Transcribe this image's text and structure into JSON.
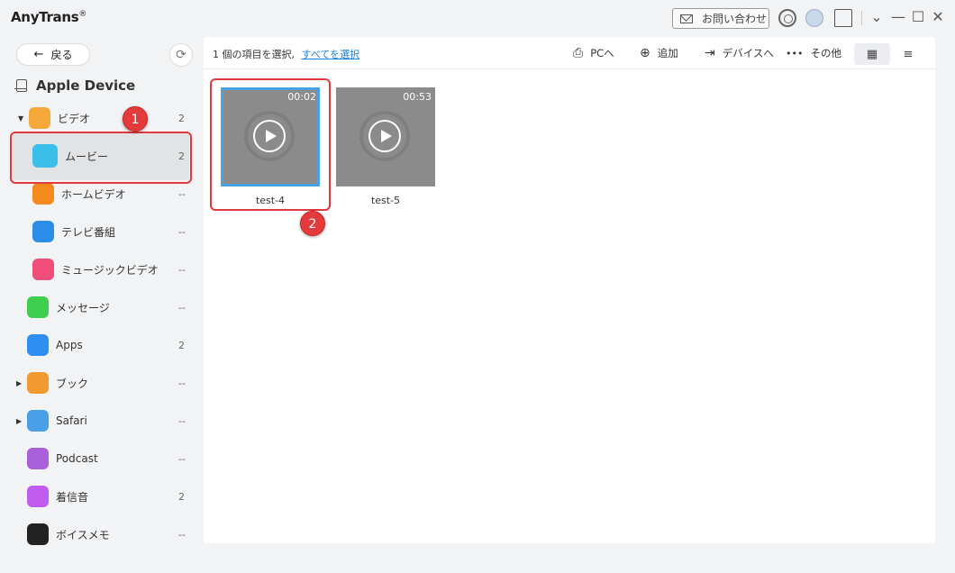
{
  "app": {
    "title": "AnyTrans",
    "reg": "®"
  },
  "titlebar": {
    "contact_label": "お問い合わせ",
    "controls": {
      "chevron": "⌄",
      "minimize": "—",
      "maximize": "☐",
      "close": "✕"
    }
  },
  "sidebar": {
    "back_label": "戻る",
    "back_arrow": "←",
    "refresh_icon": "⟳",
    "device_name": "Apple Device",
    "items": [
      {
        "label": "ビデオ",
        "count": "2",
        "caret": "▼",
        "icon": "video-category-icon",
        "color": "#f4a93a"
      },
      {
        "label": "ムービー",
        "count": "2",
        "icon": "clapperboard-icon",
        "color": "#3ac0e8"
      },
      {
        "label": "ホームビデオ",
        "count": "--",
        "icon": "home-video-icon",
        "color": "#f58a1f"
      },
      {
        "label": "テレビ番組",
        "count": "--",
        "icon": "tv-icon",
        "color": "#2b8de6"
      },
      {
        "label": "ミュージックビデオ",
        "count": "--",
        "icon": "music-video-icon",
        "color": "#ef4d7a"
      },
      {
        "label": "メッセージ",
        "count": "--",
        "icon": "message-icon",
        "color": "#3ecf4f"
      },
      {
        "label": "Apps",
        "count": "2",
        "icon": "app-store-icon",
        "color": "#2f8ff0"
      },
      {
        "label": "ブック",
        "count": "--",
        "caret": "▶",
        "icon": "book-icon",
        "color": "#f19a2f"
      },
      {
        "label": "Safari",
        "count": "--",
        "caret": "▶",
        "icon": "safari-icon",
        "color": "#4aa0e6"
      },
      {
        "label": "Podcast",
        "count": "--",
        "icon": "podcast-icon",
        "color": "#a85fd8"
      },
      {
        "label": "着信音",
        "count": "2",
        "icon": "bell-icon",
        "color": "#c25cf0"
      },
      {
        "label": "ボイスメモ",
        "count": "--",
        "icon": "voice-memo-icon",
        "color": "#222222"
      }
    ]
  },
  "toolbar": {
    "selection_text": "1 個の項目を選択,",
    "select_all_link": "すべてを選択",
    "to_pc": "PCへ",
    "add": "追加",
    "to_device": "デバイスへ",
    "more": "その他",
    "to_pc_icon": "⎙",
    "add_icon": "⊕",
    "to_device_icon": "⇥",
    "more_icon": "•••",
    "grid_view_icon": "▦",
    "list_view_icon": "≡"
  },
  "videos": [
    {
      "name": "test-4",
      "duration": "00:02",
      "selected": true
    },
    {
      "name": "test-5",
      "duration": "00:53",
      "selected": false
    }
  ],
  "annotations": {
    "step1": "1",
    "step2": "2"
  }
}
